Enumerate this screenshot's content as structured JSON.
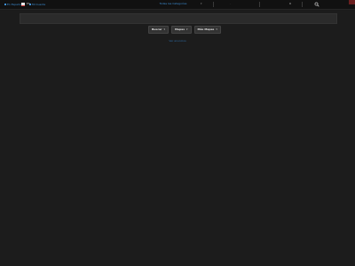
{
  "topbar": {
    "link1": "En Español",
    "link2": "Mi Cuenta"
  },
  "navbar": {
    "language_indicator": "ES",
    "center_link": "Todas las Categorías",
    "count": "0",
    "search_icon": "search-icon"
  },
  "buttons": [
    {
      "label": "Buscar"
    },
    {
      "label": "Mapas"
    },
    {
      "label": "Más Mapas"
    }
  ],
  "bottom_link": "Ver anuncios",
  "colors": {
    "background": "#1c1c1c",
    "link": "#3d8fd6",
    "button_bg": "#333333"
  }
}
